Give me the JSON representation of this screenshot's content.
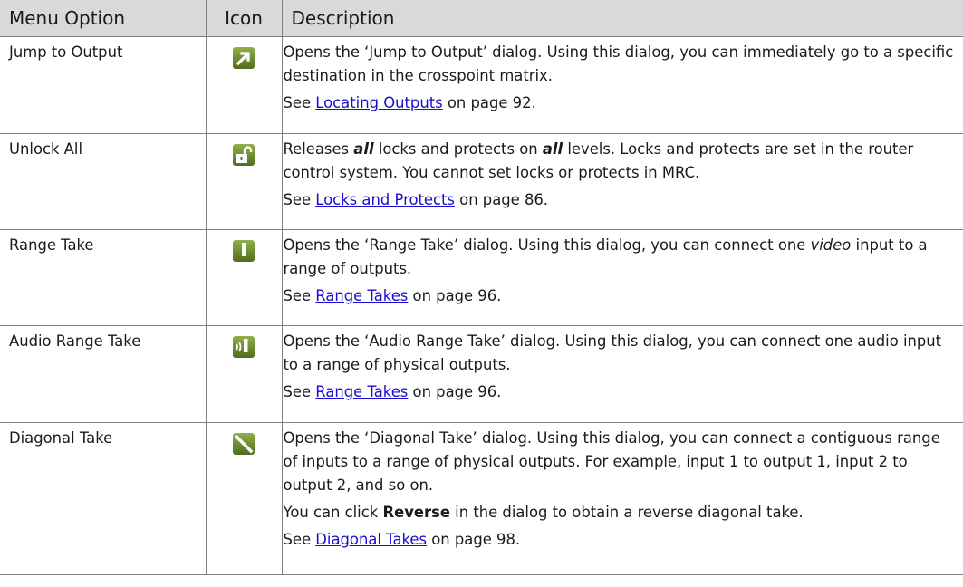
{
  "header": {
    "option": "Menu Option",
    "icon": "Icon",
    "description": "Description"
  },
  "rows": [
    {
      "option": "Jump to Output",
      "icon": "jump-arrow-icon",
      "desc": {
        "a": "Opens the ‘Jump to Output’ dialog. Using this dialog, you can immediately go to a specific destination in the crosspoint matrix."
      },
      "see": {
        "prefix": "See ",
        "link": "Locating Outputs",
        "suffix": " on page 92."
      }
    },
    {
      "option": "Unlock All",
      "icon": "unlock-padlock-icon",
      "desc": {
        "a": "Releases ",
        "b": "all",
        "c": " locks and protects on ",
        "d": "all",
        "e": " levels. Locks and protects are set in the router control system. You cannot set locks or protects in MRC."
      },
      "see": {
        "prefix": "See ",
        "link": "Locks and Protects",
        "suffix": " on page 86."
      }
    },
    {
      "option": "Range Take",
      "icon": "range-take-icon",
      "desc": {
        "a": "Opens the ‘Range Take’ dialog. Using this dialog, you can connect one ",
        "b": "video",
        "c": " input to a range of outputs."
      },
      "see": {
        "prefix": "See ",
        "link": "Range Takes",
        "suffix": " on page 96."
      }
    },
    {
      "option": "Audio Range Take",
      "icon": "audio-range-take-icon",
      "desc": {
        "a": "Opens the ‘Audio Range Take’ dialog. Using this dialog, you can connect one audio input to a range of physical outputs."
      },
      "see": {
        "prefix": "See ",
        "link": "Range Takes",
        "suffix": " on page 96."
      }
    },
    {
      "option": "Diagonal Take",
      "icon": "diagonal-take-icon",
      "desc": {
        "a": "Opens the ‘Diagonal Take’ dialog. Using this dialog, you can connect a contiguous range of inputs to a range of physical outputs. For example, input 1 to output 1, input 2 to output 2, and so on.",
        "p2a": "You can click ",
        "p2b": "Reverse",
        "p2c": " in the dialog to obtain a reverse diagonal take."
      },
      "see": {
        "prefix": "See ",
        "link": "Diagonal Takes",
        "suffix": " on page 98."
      }
    }
  ],
  "colors": {
    "header_bg": "#d9d9d9",
    "icon_green": "#6a8f2a",
    "link": "#1a0dcc",
    "border": "#7f7f7f"
  }
}
